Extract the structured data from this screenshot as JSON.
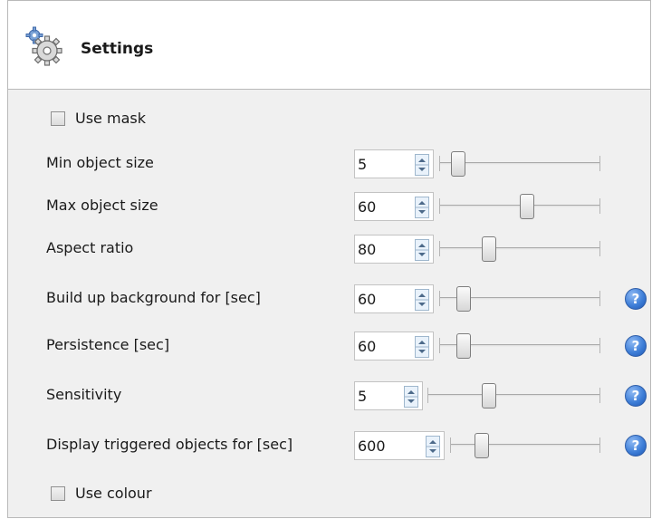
{
  "header": {
    "title": "Settings",
    "icon": "gear-settings-icon"
  },
  "use_mask": {
    "label": "Use mask",
    "checked": false
  },
  "use_colour": {
    "label": "Use colour",
    "checked": false
  },
  "rows": [
    {
      "label": "Min object size",
      "value": "5",
      "slider_level": 0.08,
      "help": false
    },
    {
      "label": "Max object size",
      "value": "60",
      "slider_level": 0.55,
      "help": false
    },
    {
      "label": "Aspect ratio",
      "value": "80",
      "slider_level": 0.29,
      "help": false
    },
    {
      "label": "Build up background for [sec]",
      "value": "60",
      "slider_level": 0.12,
      "help": true
    },
    {
      "label": "Persistence [sec]",
      "value": "60",
      "slider_level": 0.12,
      "help": true
    },
    {
      "label": "Sensitivity",
      "value": "5",
      "slider_level": 0.34,
      "help": true
    },
    {
      "label": "Display triggered objects for [sec]",
      "value": "600",
      "slider_level": 0.18,
      "help": true
    }
  ],
  "help_icon": {
    "glyph": "?",
    "color": "#3f7fd8"
  }
}
